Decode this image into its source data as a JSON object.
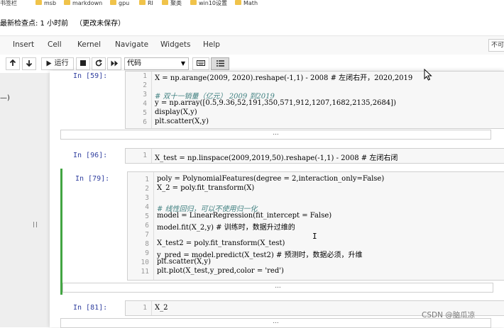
{
  "bookmarks": [
    {
      "label": "书签栏"
    },
    {
      "label": "msb"
    },
    {
      "label": "markdown"
    },
    {
      "label": "gpu"
    },
    {
      "label": "RI"
    },
    {
      "label": "聚类"
    },
    {
      "label": "win10设置"
    },
    {
      "label": "Math"
    }
  ],
  "header": {
    "checkpoint": "最新检查点: 1 小时前",
    "unsaved": "（更改未保存）"
  },
  "menubar": {
    "items": [
      "Insert",
      "Cell",
      "Kernel",
      "Navigate",
      "Widgets",
      "Help"
    ],
    "trusted": "不可信"
  },
  "toolbar": {
    "run_label": "运行",
    "cell_type": "代码"
  },
  "left_panel": {
    "text": "—)"
  },
  "cells": [
    {
      "prompt": "In  [59]:",
      "lines": [
        "X = np.arange(2009, 2020).reshape(-1,1) - 2008 # 左闭右开，2020,2019",
        "",
        "# 双十一销量（亿元） 2009 到2019",
        "y = np.array([0.5,9.36,52,191,350,571,912,1207,1682,2135,2684])",
        "display(X,y)",
        "plt.scatter(X,y)"
      ]
    },
    {
      "prompt": "In  [96]:",
      "lines": [
        "X_test = np.linspace(2009,2019,50).reshape(-1,1) - 2008 # 左闭右闭"
      ]
    },
    {
      "prompt": "In  [79]:",
      "lines": [
        "poly = PolynomialFeatures(degree = 2,interaction_only=False)",
        "X_2 = poly.fit_transform(X)",
        "",
        "# 线性回归，可以不使用归一化",
        "model = LinearRegression(fit_intercept = False)",
        "model.fit(X_2,y) # 训练时，数据升过维的",
        "",
        "X_test2 = poly.fit_transform(X_test)",
        "y_pred = model.predict(X_test2) # 预测时，数据必须，升维",
        "plt.scatter(X,y)",
        "plt.plot(X_test,y_pred,color = 'red')"
      ]
    },
    {
      "prompt": "In  [81]:",
      "lines": [
        "X_2"
      ]
    }
  ],
  "collapsed_label": "...",
  "watermark": "CSDN @脑瓜凉"
}
